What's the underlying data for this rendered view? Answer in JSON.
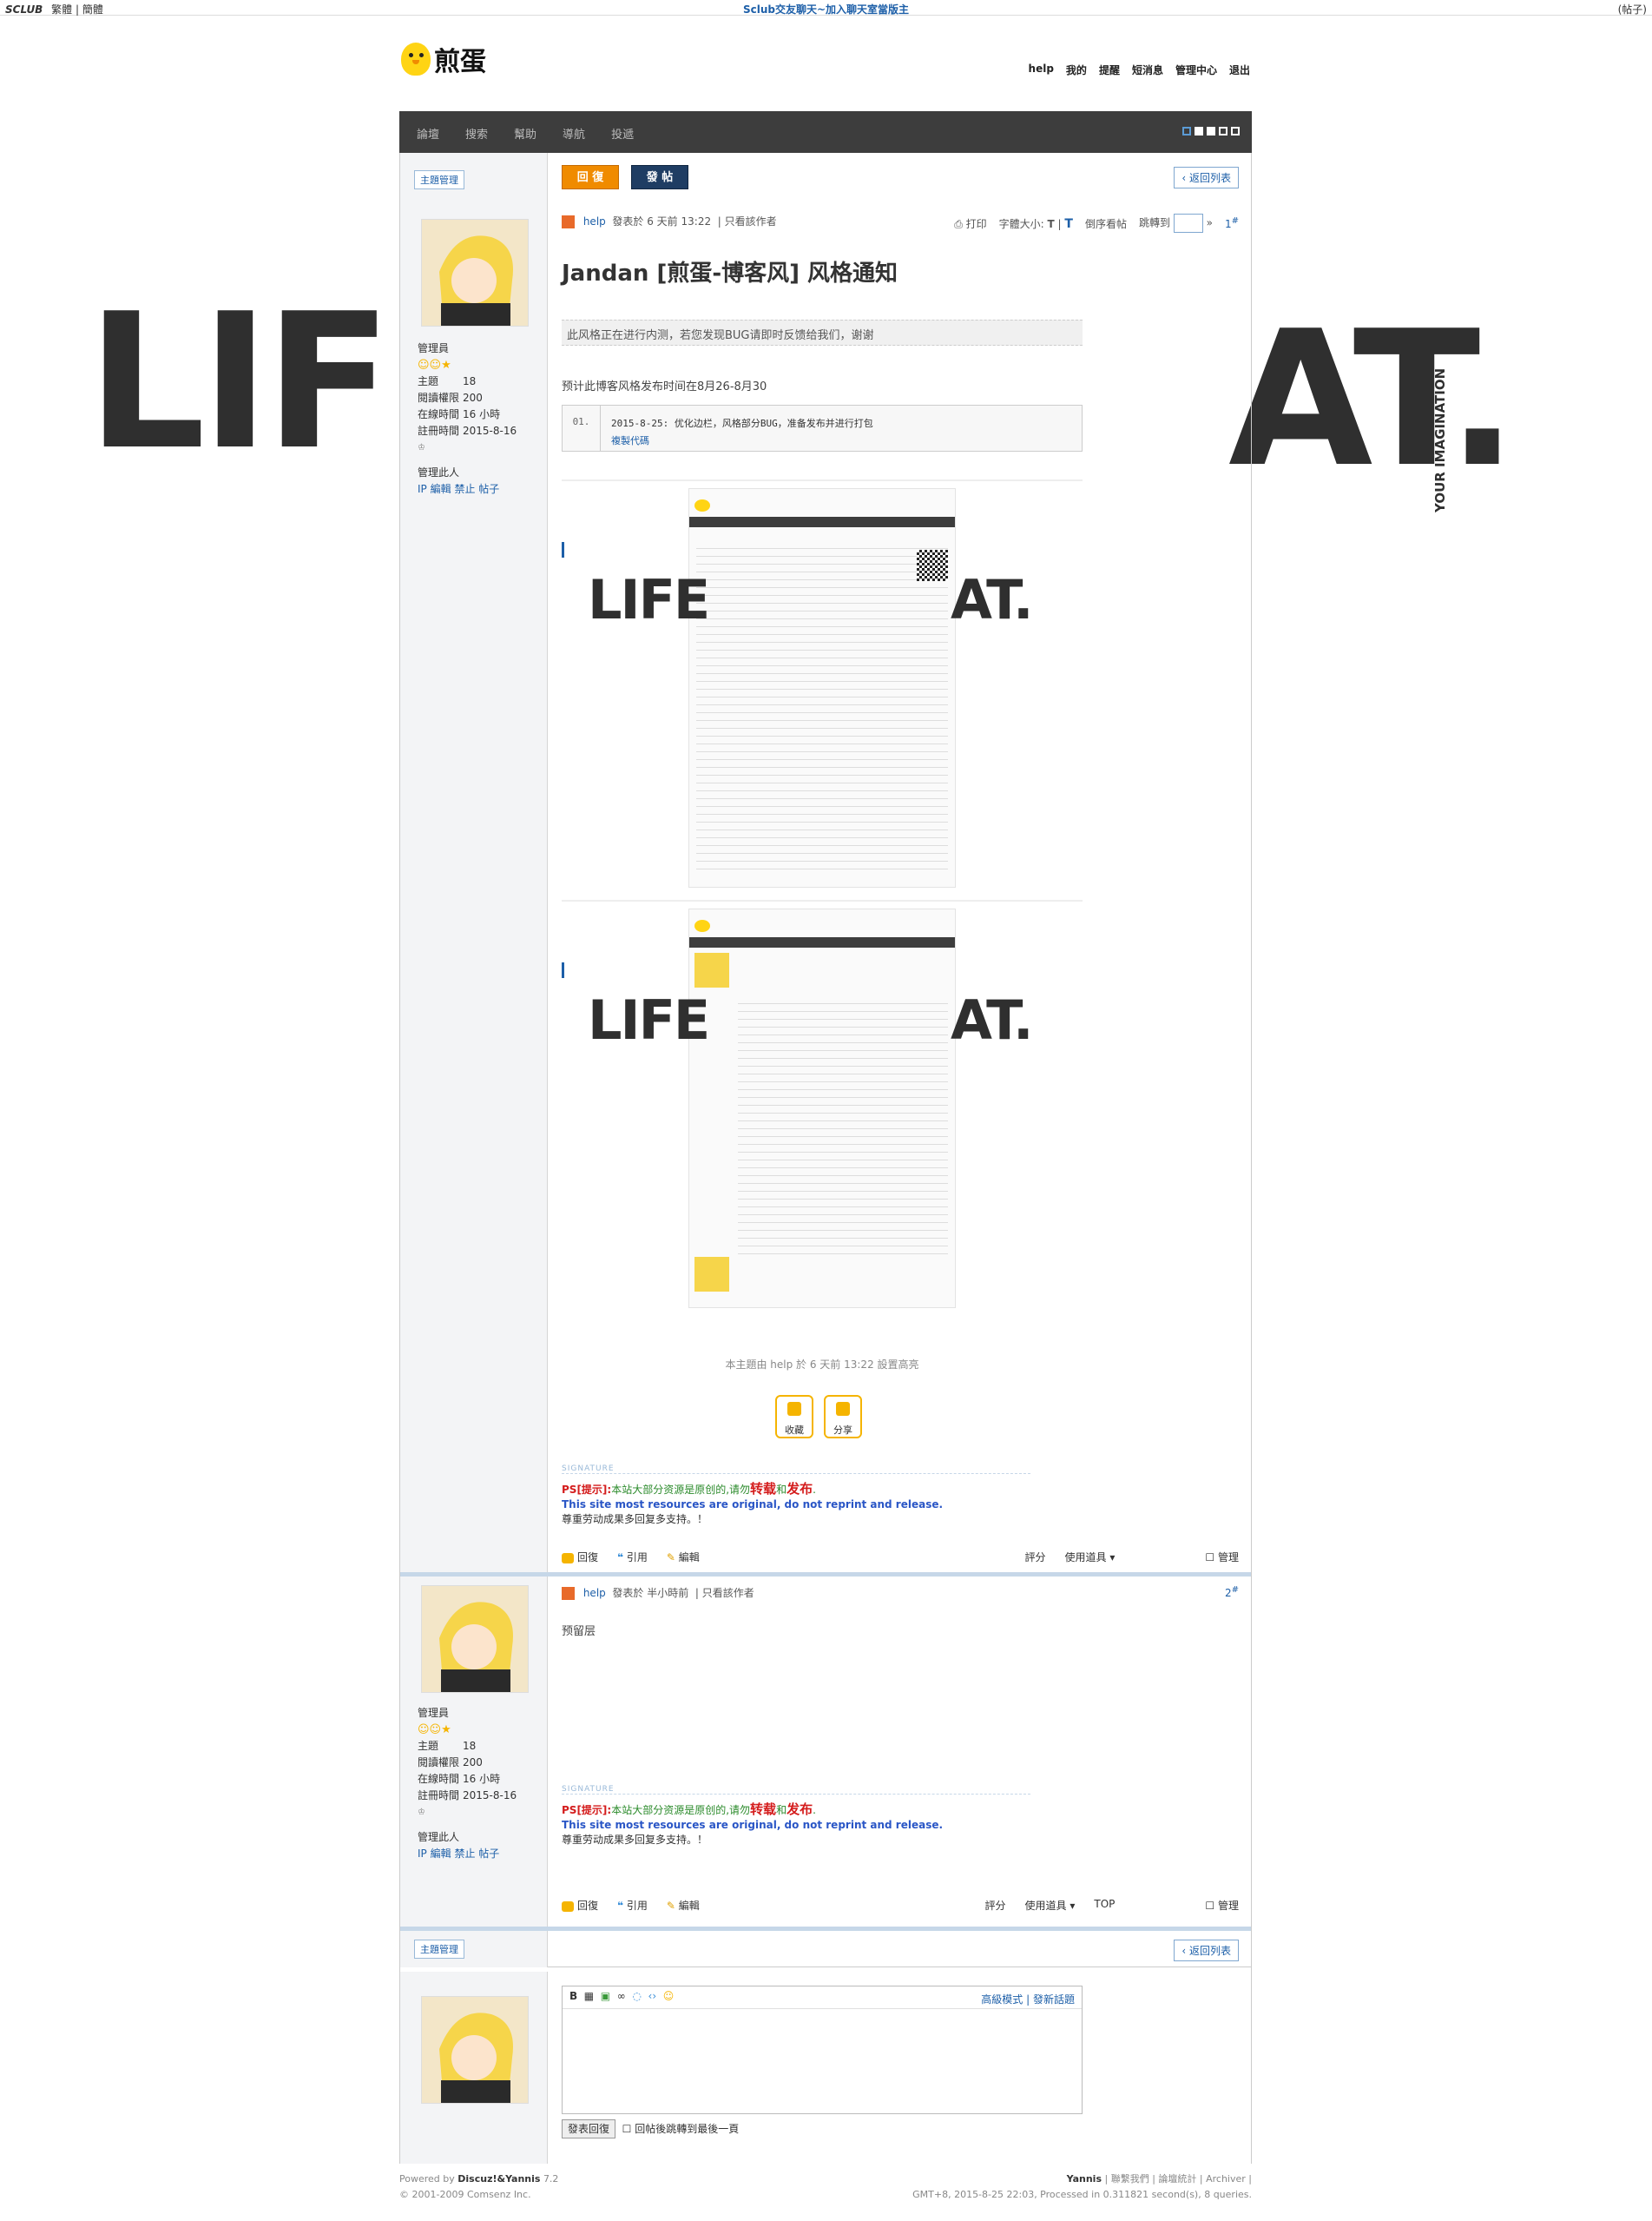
{
  "topbar": {
    "brand": "SCLUB",
    "links": [
      "繁體",
      "簡體"
    ],
    "center_link": "Sclub交友聊天~加入聊天室當版主",
    "right_link": "(帖子)"
  },
  "watermark": {
    "left_text": "LIFE",
    "right_text": "AT.",
    "vertical_text": "YOUR IMAGINATION"
  },
  "site": {
    "logo_text": "煎蛋",
    "user_nav": [
      "help",
      "我的",
      "提醒",
      "短消息",
      "管理中心",
      "退出"
    ]
  },
  "nav": {
    "items": [
      "論壇",
      "搜索",
      "幫助",
      "導航",
      "投遞"
    ]
  },
  "toolbar": {
    "reply_label": "回 復",
    "post_label": "發 帖",
    "back_label": "返回列表",
    "topic_manage_label": "主題管理"
  },
  "post1": {
    "author": "help",
    "posted": "發表於 6 天前 13:22",
    "only_author": "只看該作者",
    "print_label": "打印",
    "font_size_label": "字體大小:",
    "font_small": "T",
    "font_big": "T",
    "reverse_label": "倒序看帖",
    "goto_label": "跳轉到",
    "floor_no": "1",
    "floor_sup": "#",
    "title": "Jandan [煎蛋-博客风] 风格通知",
    "notice": "此风格正在进行内测，若您发现BUG请即时反馈给我们，谢谢",
    "release_text": "预计此博客风格发布时间在8月26-8月30",
    "code_line_no": "01.",
    "code_text": "2015-8-25: 优化边栏，风格部分BUG，准备发布并进行打包",
    "copy_code_label": "複製代碼",
    "highlight_note": "本主題由 help 於 6 天前 13:22 設置高亮",
    "fav_label": "收藏",
    "share_label": "分享"
  },
  "user": {
    "group": "管理員",
    "stats": [
      {
        "label": "主題",
        "value": "18"
      },
      {
        "label": "閱讀權限",
        "value": "200"
      },
      {
        "label": "在線時間",
        "value": "16 小時"
      },
      {
        "label": "註冊時間",
        "value": "2015-8-16"
      }
    ],
    "manage_label": "管理此人",
    "admin_links": [
      "IP",
      "編輯",
      "禁止",
      "帖子"
    ]
  },
  "signature": {
    "head": "SIGNATURE",
    "line1_prefix": "PS[提示]:",
    "line1_text": "本站大部分资源是原创的,请勿",
    "line1_word1": "转载",
    "line1_and": "和",
    "line1_word2": "发布",
    "line1_end": ".",
    "line2": "This site most resources are original, do not reprint and release.",
    "line3": "尊重劳动成果多回复多支持。！"
  },
  "post_actions": {
    "reply": "回復",
    "quote": "引用",
    "edit": "編輯",
    "rate": "評分",
    "tools": "使用道具",
    "top": "TOP",
    "manage": "管理"
  },
  "post2": {
    "author": "help",
    "posted": "發表於 半小時前",
    "only_author": "只看該作者",
    "floor_no": "2",
    "floor_sup": "#",
    "body": "预留层"
  },
  "quickreply": {
    "advanced": "高級模式",
    "new_topic": "發新話題",
    "submit": "發表回復",
    "goto_last": "回帖後跳轉到最後一頁"
  },
  "footer": {
    "powered": "Powered by",
    "brand": "Discuz!&Yannis",
    "version": "7.2",
    "copyright": "© 2001-2009 Comsenz Inc.",
    "links": [
      "Yannis",
      "聯繫我們",
      "論壇統計",
      "Archiver"
    ],
    "info": "GMT+8, 2015-8-25 22:03, Processed in 0.311821 second(s), 8 queries."
  },
  "colors": {
    "nav_bg": "#3d3d3d",
    "reply_btn": "#f08b00",
    "post_btn": "#1f3d63",
    "link_blue": "#1d5fa8",
    "logo_yellow": "#ffd414"
  }
}
